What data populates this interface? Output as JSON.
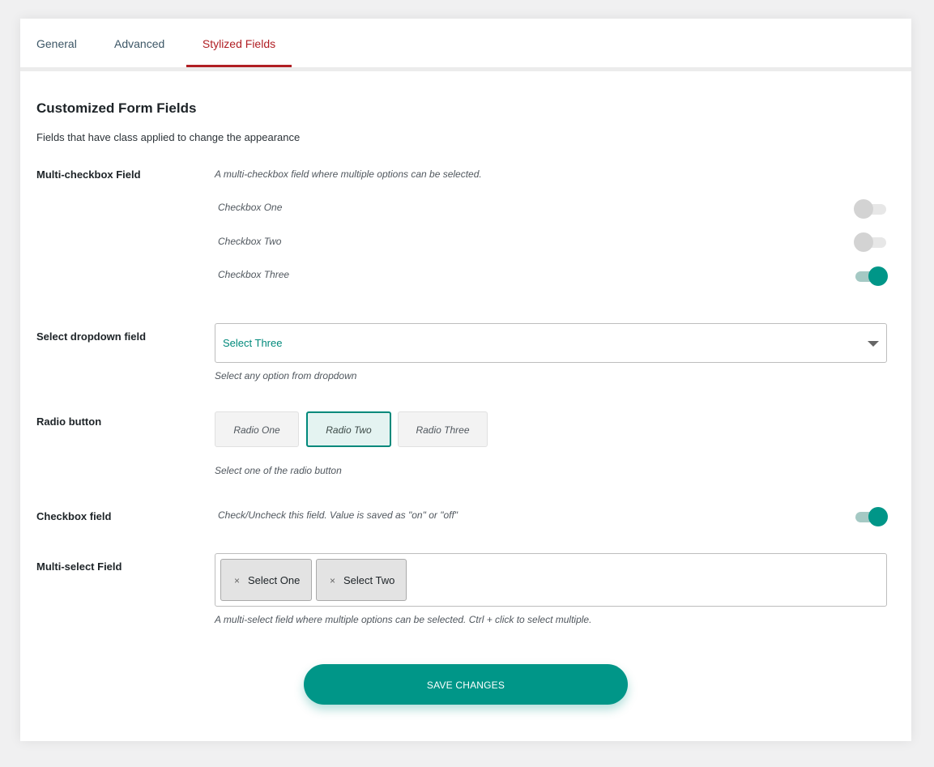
{
  "tabs": [
    {
      "label": "General"
    },
    {
      "label": "Advanced"
    },
    {
      "label": "Stylized Fields"
    }
  ],
  "section": {
    "title": "Customized Form Fields",
    "description": "Fields that have class applied to change the appearance"
  },
  "multi_checkbox": {
    "label": "Multi-checkbox Field",
    "hint": "A multi-checkbox field where multiple options can be selected.",
    "options": [
      {
        "label": "Checkbox One",
        "checked": false
      },
      {
        "label": "Checkbox Two",
        "checked": false
      },
      {
        "label": "Checkbox Three",
        "checked": true
      }
    ]
  },
  "select_field": {
    "label": "Select dropdown field",
    "value": "Select Three",
    "hint": "Select any option from dropdown"
  },
  "radio_field": {
    "label": "Radio button",
    "options": [
      "Radio One",
      "Radio Two",
      "Radio Three"
    ],
    "selected": "Radio Two",
    "hint": "Select one of the radio button"
  },
  "checkbox_field": {
    "label": "Checkbox field",
    "hint": "Check/Uncheck this field. Value is saved as \"on\" or \"off\"",
    "checked": true
  },
  "multi_select": {
    "label": "Multi-select Field",
    "selected": [
      "Select One",
      "Select Two"
    ],
    "remove_glyph": "×",
    "hint": "A multi-select field where multiple options can be selected. Ctrl + click to select multiple."
  },
  "save_button": {
    "label": "SAVE CHANGES"
  },
  "colors": {
    "accent": "#009688",
    "active_tab": "#b01e23"
  }
}
